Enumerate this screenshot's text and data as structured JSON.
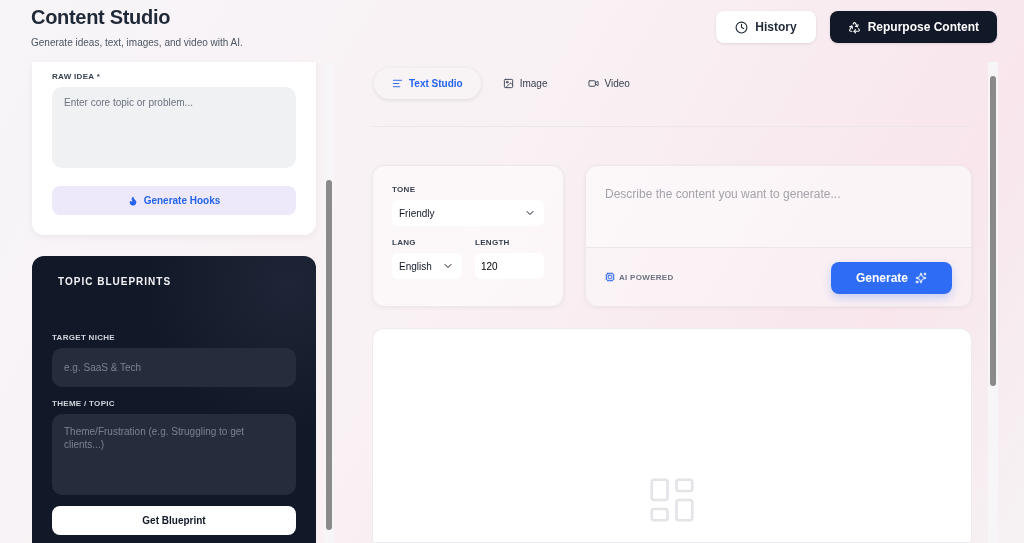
{
  "header": {
    "title": "Content Studio",
    "subtitle": "Generate ideas, text, images, and video with AI.",
    "buttons": [
      {
        "kind": "history",
        "label": "History"
      },
      {
        "kind": "repurpose",
        "label": "Repurpose Content"
      }
    ]
  },
  "idea_card": {
    "label": "RAW IDEA *",
    "placeholder": "Enter core topic or problem...",
    "button": "Generate Hooks"
  },
  "blueprint_card": {
    "title": "TOPIC BLUEPRINTS",
    "niche_label": "TARGET NICHE",
    "niche_placeholder": "e.g. SaaS & Tech",
    "topic_label": "THEME / TOPIC",
    "topic_placeholder": "Theme/Frustration (e.g. Struggling to get clients...)",
    "button": "Get Blueprint"
  },
  "tabs": [
    {
      "kind": "text",
      "label": "Text Studio",
      "selected": true
    },
    {
      "kind": "image",
      "label": "Image",
      "selected": false
    },
    {
      "kind": "video",
      "label": "Video",
      "selected": false
    }
  ],
  "settings": {
    "tone_label": "TONE",
    "tone": "Friendly",
    "lang_label": "LANG",
    "lang": "English",
    "length_label": "LENGTH",
    "length": "120"
  },
  "prompt": {
    "placeholder": "Describe the content you want to generate...",
    "badge": "AI POWERED",
    "button": "Generate"
  }
}
